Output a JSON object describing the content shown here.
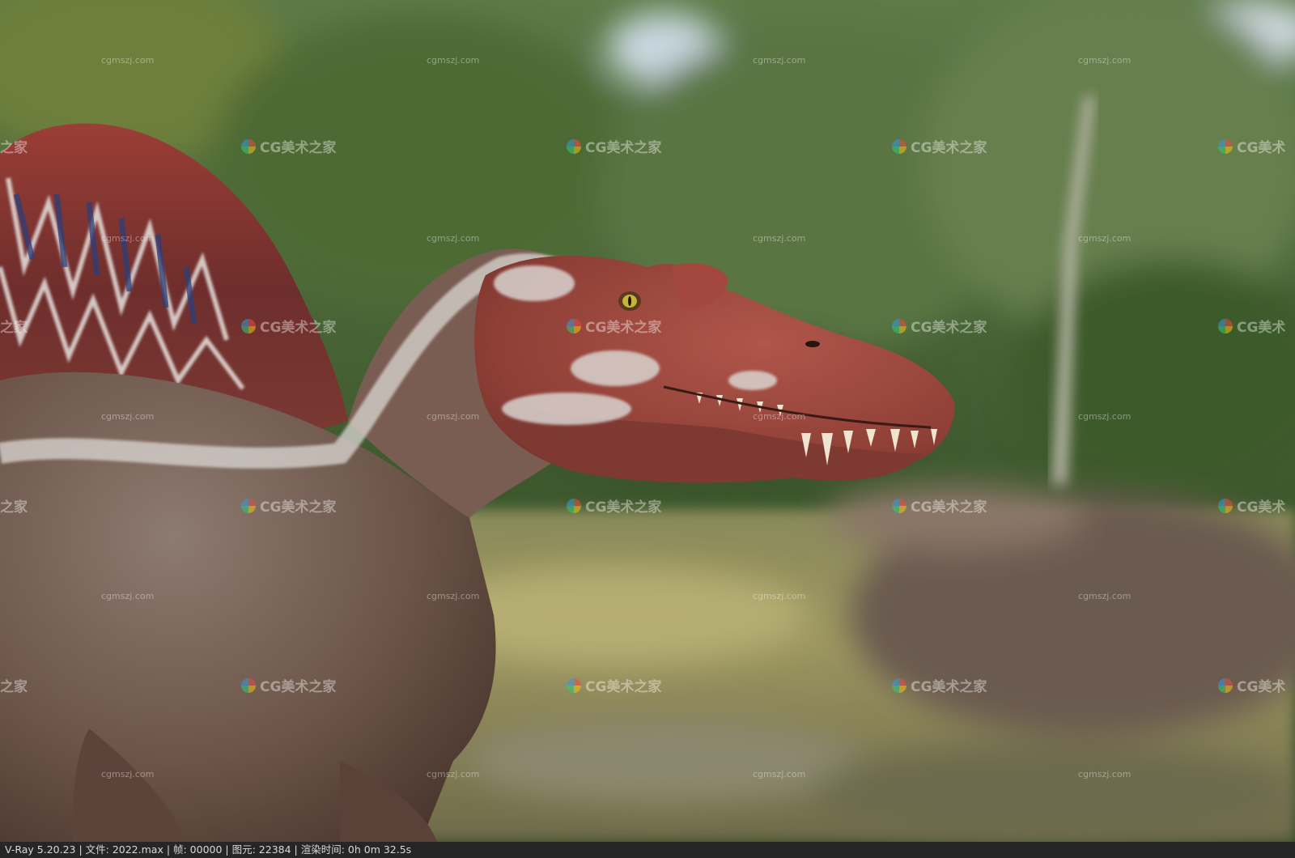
{
  "status_bar": {
    "text": "V-Ray 5.20.23 | 文件: 2022.max | 帧: 00000 | 图元: 22384 | 渲染时间:  0h  0m 32.5s"
  },
  "watermarks": {
    "small_text": "cgmszj.com",
    "big_text": "CG美术之家",
    "big_text_edge": "之家",
    "big_text_clip": "CG美术"
  },
  "icons": {
    "watermark_logo": "cg-logo-icon"
  }
}
